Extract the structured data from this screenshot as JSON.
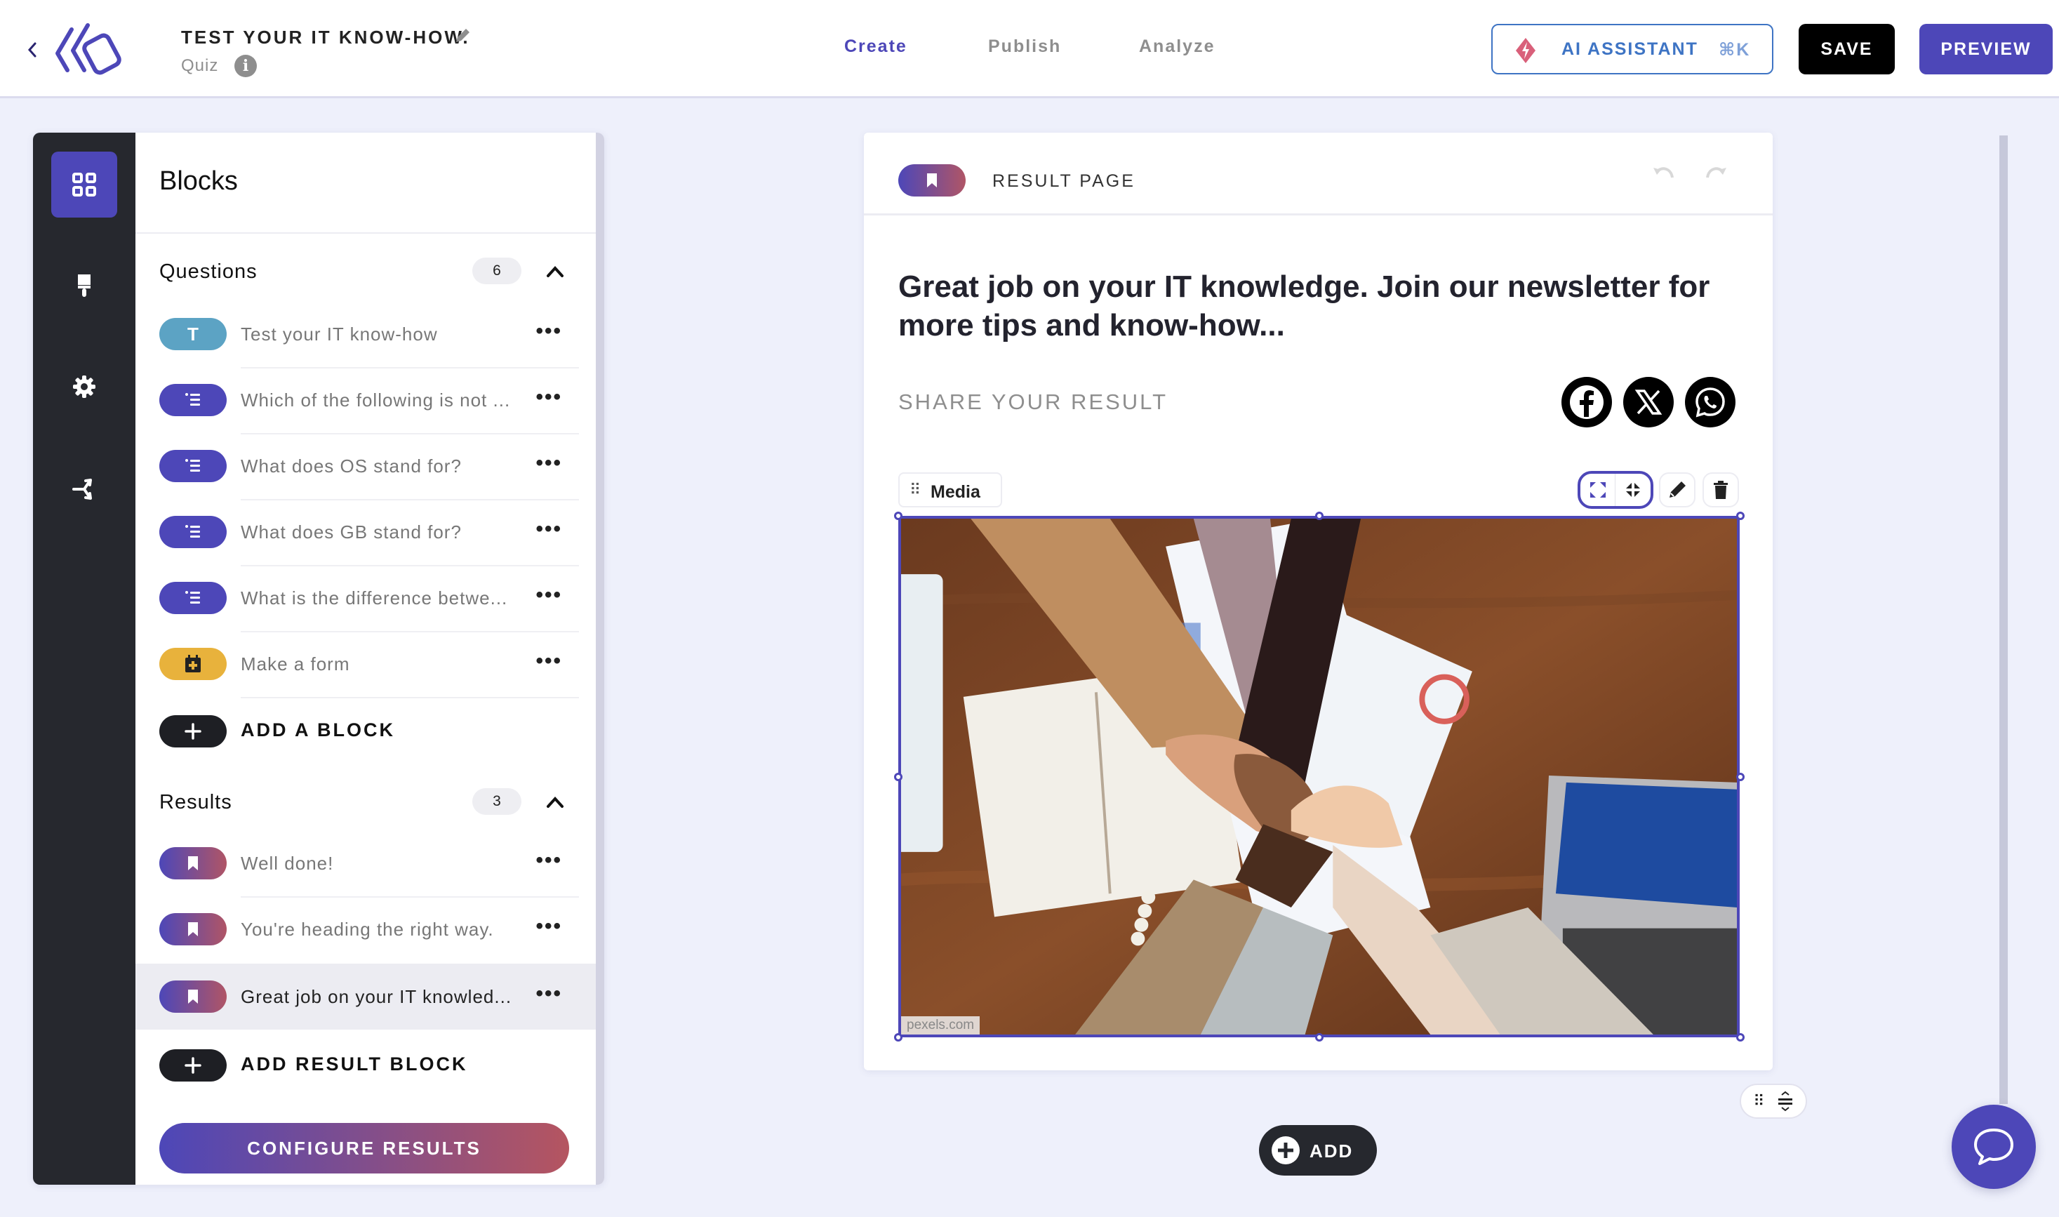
{
  "header": {
    "back_icon": "chevron-left-icon",
    "logo": "app-logo",
    "title": "TEST YOUR IT KNOW-HOW.",
    "title_edit_icon": "pencil-icon",
    "subtitle": "Quiz",
    "info_icon": "info-icon",
    "info_glyph": "i",
    "tabs": [
      {
        "label": "Create",
        "active": true
      },
      {
        "label": "Publish",
        "active": false
      },
      {
        "label": "Analyze",
        "active": false
      }
    ],
    "ai_assistant": {
      "label": "AI ASSISTANT",
      "shortcut": "⌘K",
      "icon": "lightning-icon"
    },
    "save_label": "SAVE",
    "preview_label": "PREVIEW"
  },
  "rail": {
    "items": [
      {
        "name": "blocks",
        "icon": "grid-icon",
        "active": true
      },
      {
        "name": "design",
        "icon": "paint-brush-icon",
        "active": false
      },
      {
        "name": "settings",
        "icon": "gear-icon",
        "active": false
      },
      {
        "name": "logic",
        "icon": "branch-icon",
        "active": false
      }
    ]
  },
  "panel": {
    "title": "Blocks",
    "questions": {
      "title": "Questions",
      "count": "6",
      "items": [
        {
          "label": "Test your IT know-how",
          "type": "text",
          "pill_glyph": "T"
        },
        {
          "label": "Which of the following is not ...",
          "type": "list"
        },
        {
          "label": "What does OS stand for?",
          "type": "list"
        },
        {
          "label": "What does GB stand for?",
          "type": "list"
        },
        {
          "label": "What is the difference betwe...",
          "type": "list"
        },
        {
          "label": "Make a form",
          "type": "form"
        }
      ],
      "add_label": "ADD A BLOCK"
    },
    "results": {
      "title": "Results",
      "count": "3",
      "items": [
        {
          "label": "Well done!",
          "selected": false
        },
        {
          "label": "You're heading the right way.",
          "selected": false
        },
        {
          "label": "Great job on your IT knowled...",
          "selected": true
        }
      ],
      "add_label": "ADD RESULT BLOCK"
    },
    "more_glyph": "•••",
    "configure_label": "CONFIGURE RESULTS"
  },
  "canvas": {
    "page_type": "RESULT PAGE",
    "headline": "Great job on your IT knowledge. Join our newsletter for more tips and know-how...",
    "share_label": "SHARE YOUR RESULT",
    "social": [
      {
        "name": "facebook",
        "icon": "facebook-icon"
      },
      {
        "name": "x",
        "icon": "x-icon"
      },
      {
        "name": "whatsapp",
        "icon": "whatsapp-icon"
      }
    ],
    "media": {
      "chip_label": "Media",
      "chip_dots": "⠿",
      "image_description": "Team stacking hands over wooden desk with laptop, notebook and charts",
      "credit": "pexels.com"
    },
    "add_label": "ADD"
  },
  "colors": {
    "accent": "#4d47b8",
    "dark": "#26282e",
    "teal": "#5ca3c4",
    "yellow": "#e8b23c",
    "gradient_start": "#4d47b8",
    "gradient_end": "#b55560",
    "ai_blue": "#3e74c4",
    "background": "#eef0fb"
  }
}
